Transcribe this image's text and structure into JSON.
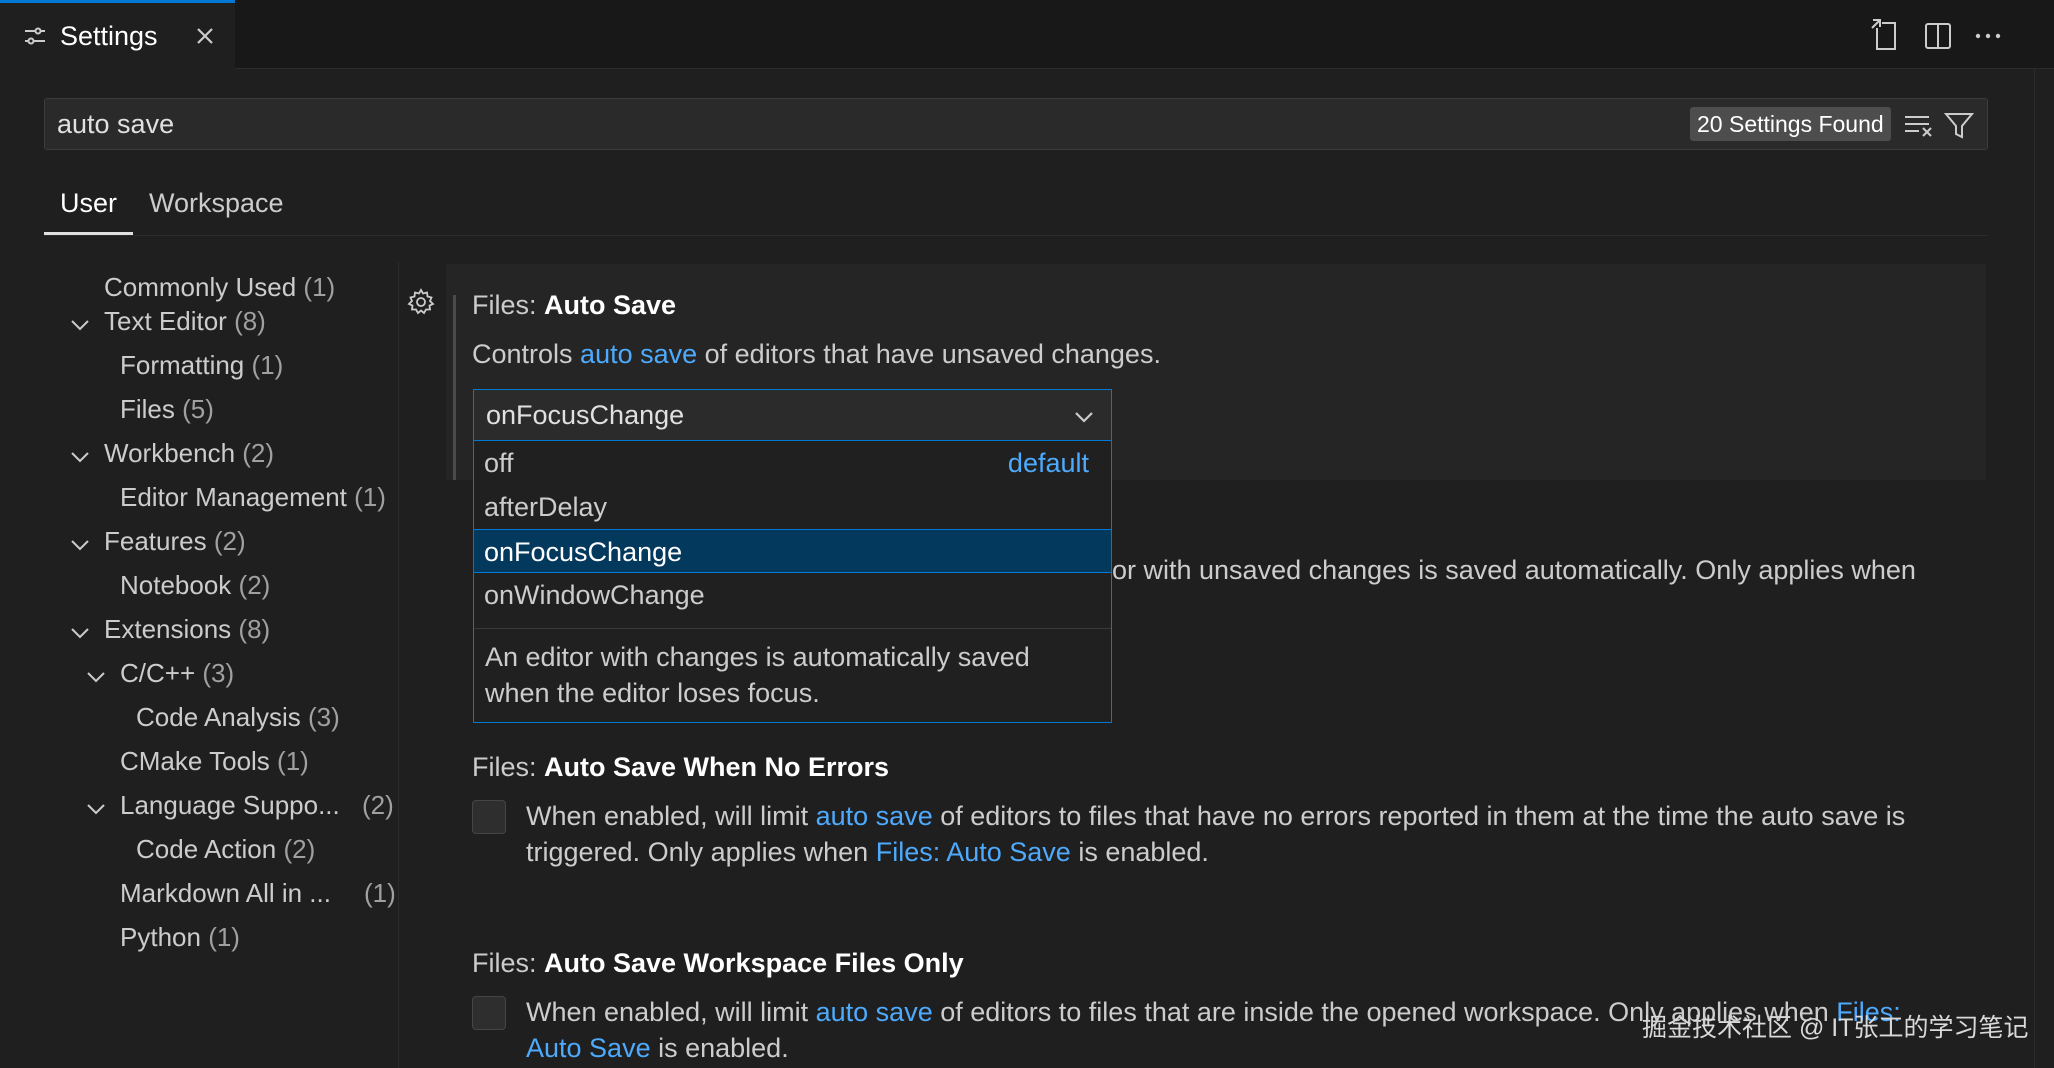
{
  "tab": {
    "title": "Settings"
  },
  "search": {
    "value": "auto save",
    "found": "20 Settings Found"
  },
  "scope_tabs": [
    "User",
    "Workspace"
  ],
  "toc": [
    {
      "label": "Commonly Used",
      "count": "(1)"
    },
    {
      "label": "Text Editor",
      "count": "(8)"
    },
    {
      "label": "Formatting",
      "count": "(1)"
    },
    {
      "label": "Files",
      "count": "(5)"
    },
    {
      "label": "Workbench",
      "count": "(2)"
    },
    {
      "label": "Editor Management",
      "count": "(1)"
    },
    {
      "label": "Features",
      "count": "(2)"
    },
    {
      "label": "Notebook",
      "count": "(2)"
    },
    {
      "label": "Extensions",
      "count": "(8)"
    },
    {
      "label": "C/C++",
      "count": "(3)"
    },
    {
      "label": "Code Analysis",
      "count": "(3)"
    },
    {
      "label": "CMake Tools",
      "count": "(1)"
    },
    {
      "label": "Language Suppo...",
      "count": "(2)"
    },
    {
      "label": "Code Action",
      "count": "(2)"
    },
    {
      "label": "Markdown All in ...",
      "count": "(1)"
    },
    {
      "label": "Python",
      "count": "(1)"
    }
  ],
  "settings": {
    "auto_save": {
      "category": "Files: ",
      "name": "Auto Save",
      "desc_pre": "Controls ",
      "desc_link": "auto save",
      "desc_post": " of editors that have unsaved changes.",
      "value": "onFocusChange",
      "options": [
        "off",
        "afterDelay",
        "onFocusChange",
        "onWindowChange"
      ],
      "default_label": "default",
      "option_desc": "An editor with changes is automatically saved when the editor loses focus.",
      "behind_text": "or with unsaved changes is saved automatically. Only applies when"
    },
    "no_errors": {
      "category": "Files: ",
      "name": "Auto Save When No Errors",
      "desc_pre": "When enabled, will limit ",
      "desc_link": "auto save",
      "desc_mid": " of editors to files that have no errors reported in them at the time the auto save is",
      "desc_pre2": "triggered. Only applies when ",
      "desc_link2": "Files: Auto Save",
      "desc_post2": " is enabled."
    },
    "workspace_only": {
      "category": "Files: ",
      "name": "Auto Save Workspace Files Only",
      "desc_pre": "When enabled, will limit ",
      "desc_link": "auto save",
      "desc_mid": " of editors to files that are inside the opened workspace. Only applies when ",
      "desc_link_tail": "Files:",
      "desc_link2": "Auto Save",
      "desc_post2": " is enabled."
    }
  },
  "watermark": "掘金技术社区 @ IT张工的学习笔记",
  "colors": {
    "accent": "#0078d4",
    "link": "#4daafc",
    "selected": "#04395e"
  }
}
